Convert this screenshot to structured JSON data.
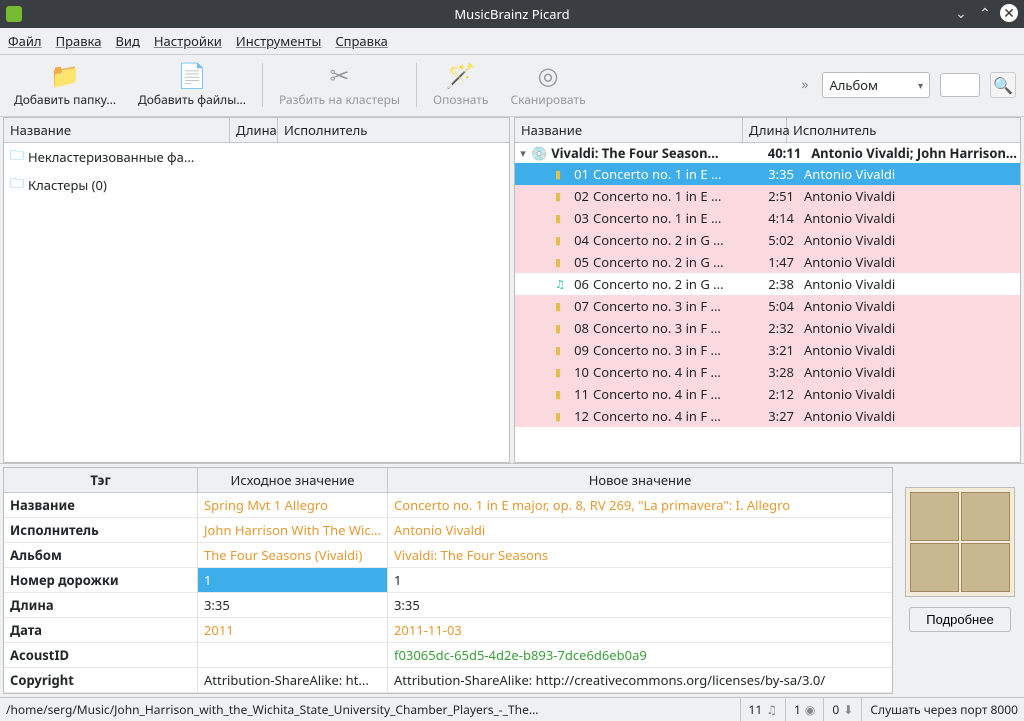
{
  "window": {
    "title": "MusicBrainz Picard"
  },
  "menubar": [
    "Файл",
    "Правка",
    "Вид",
    "Настройки",
    "Инструменты",
    "Справка"
  ],
  "toolbar": {
    "add_folder": "Добавить папку...",
    "add_files": "Добавить файлы...",
    "cluster": "Разбить на кластеры",
    "lookup": "Опознать",
    "scan": "Сканировать",
    "search_type": "Альбом"
  },
  "panes": {
    "headers": {
      "name": "Название",
      "length": "Длина",
      "artist": "Исполнитель"
    },
    "left": {
      "unclustered": "Некластеризованные фа...",
      "clusters": "Кластеры (0)"
    },
    "album": {
      "title": "Vivaldi: The Four Season...",
      "length": "40:11",
      "artist": "Antonio Vivaldi; John Harrison,...",
      "tracks": [
        {
          "num": "01",
          "title": "Concerto no. 1 in E ...",
          "length": "3:35",
          "artist": "Antonio Vivaldi",
          "status": "changed",
          "selected": true
        },
        {
          "num": "02",
          "title": "Concerto no. 1 in E ...",
          "length": "2:51",
          "artist": "Antonio Vivaldi",
          "status": "changed"
        },
        {
          "num": "03",
          "title": "Concerto no. 1 in E ...",
          "length": "4:14",
          "artist": "Antonio Vivaldi",
          "status": "changed"
        },
        {
          "num": "04",
          "title": "Concerto no. 2 in G ...",
          "length": "5:02",
          "artist": "Antonio Vivaldi",
          "status": "changed"
        },
        {
          "num": "05",
          "title": "Concerto no. 2 in G ...",
          "length": "1:47",
          "artist": "Antonio Vivaldi",
          "status": "changed"
        },
        {
          "num": "06",
          "title": "Concerto no. 2 in G ...",
          "length": "2:38",
          "artist": "Antonio Vivaldi",
          "status": "unchanged"
        },
        {
          "num": "07",
          "title": "Concerto no. 3 in F ...",
          "length": "5:04",
          "artist": "Antonio Vivaldi",
          "status": "changed"
        },
        {
          "num": "08",
          "title": "Concerto no. 3 in F ...",
          "length": "2:32",
          "artist": "Antonio Vivaldi",
          "status": "changed"
        },
        {
          "num": "09",
          "title": "Concerto no. 3 in F ...",
          "length": "3:21",
          "artist": "Antonio Vivaldi",
          "status": "changed"
        },
        {
          "num": "10",
          "title": "Concerto no. 4 in F ...",
          "length": "3:28",
          "artist": "Antonio Vivaldi",
          "status": "changed"
        },
        {
          "num": "11",
          "title": "Concerto no. 4 in F ...",
          "length": "2:12",
          "artist": "Antonio Vivaldi",
          "status": "changed"
        },
        {
          "num": "12",
          "title": "Concerto no. 4 in F ...",
          "length": "3:27",
          "artist": "Antonio Vivaldi",
          "status": "changed"
        }
      ]
    }
  },
  "tags": {
    "headers": {
      "tag": "Тэг",
      "orig": "Исходное значение",
      "newv": "Новое значение"
    },
    "rows": [
      {
        "tag": "Название",
        "orig": "Spring Mvt 1 Allegro",
        "newv": "Concerto no. 1 in E major, op. 8, RV 269, \"La primavera\": I. Allegro",
        "ocls": "orange",
        "ncls": "orange"
      },
      {
        "tag": "Исполнитель",
        "orig": "John Harrison With The Wic...",
        "newv": "Antonio Vivaldi",
        "ocls": "orange",
        "ncls": "orange"
      },
      {
        "tag": "Альбом",
        "orig": "The Four Seasons (Vivaldi)",
        "newv": "Vivaldi: The Four Seasons",
        "ocls": "orange",
        "ncls": "orange"
      },
      {
        "tag": "Номер дорожки",
        "orig": "1",
        "newv": "1",
        "sel": true
      },
      {
        "tag": "Длина",
        "orig": "3:35",
        "newv": "3:35"
      },
      {
        "tag": "Дата",
        "orig": "2011",
        "newv": "2011-11-03",
        "ocls": "orange",
        "ncls": "orange"
      },
      {
        "tag": "AcoustID",
        "orig": "",
        "newv": "f03065dc-65d5-4d2e-b893-7dce6d6eb0a9",
        "ncls": "green"
      },
      {
        "tag": "Copyright",
        "orig": "Attribution-ShareAlike: ht...",
        "newv": "Attribution-ShareAlike: http://creativecommons.org/licenses/by-sa/3.0/"
      }
    ]
  },
  "details_button": "Подробнее",
  "statusbar": {
    "path": "/home/serg/Music/John_Harrison_with_the_Wichita_State_University_Chamber_Players_-_The...",
    "count1": "11",
    "count2": "1",
    "count3": "0",
    "listening": "Слушать через порт 8000"
  }
}
